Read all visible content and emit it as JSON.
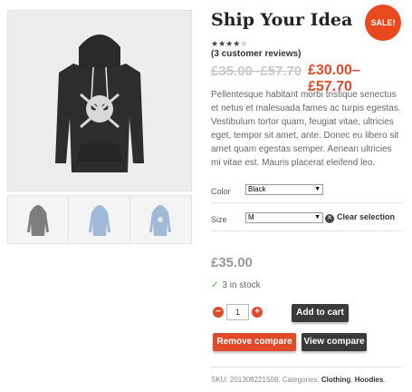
{
  "product": {
    "title": "Ship Your Idea",
    "sale_badge": "SALE!",
    "stars": "★★★★",
    "star_off": "★",
    "reviews": "(3 customer reviews)",
    "old_price": "£35.00–£57.70",
    "new_price": "£30.00–£57.70",
    "description": "Pellentesque habitant morbi tristique senectus et netus et malesuada fames ac turpis egestas. Vestibulum tortor quam, feugiat vitae, ultricies eget, tempor sit amet, ante. Donec eu libero sit amet quam egestas semper. Aenean ultricies mi vitae est. Mauris placerat eleifend leo."
  },
  "variations": {
    "color_label": "Color",
    "color_value": "Black",
    "size_label": "Size",
    "size_value": "M",
    "clear_label": "Clear selection"
  },
  "purchase": {
    "price": "£35.00",
    "stock": "3 in stock",
    "quantity": "1",
    "add_to_cart": "Add to cart",
    "remove_compare": "Remove compare",
    "view_compare": "View compare"
  },
  "meta": {
    "sku_text": "SKU: 201308221508. Categories: ",
    "cat1": "Clothing",
    "sep": ", ",
    "cat2": "Hoodies",
    "end": "."
  },
  "colors": {
    "accent": "#e04a2a",
    "dark_button": "#3a3a3a",
    "hoodie_main": "#2a2a2a",
    "thumb_gray": "#7d7d7d",
    "thumb_blue": "#9fb9d6"
  }
}
